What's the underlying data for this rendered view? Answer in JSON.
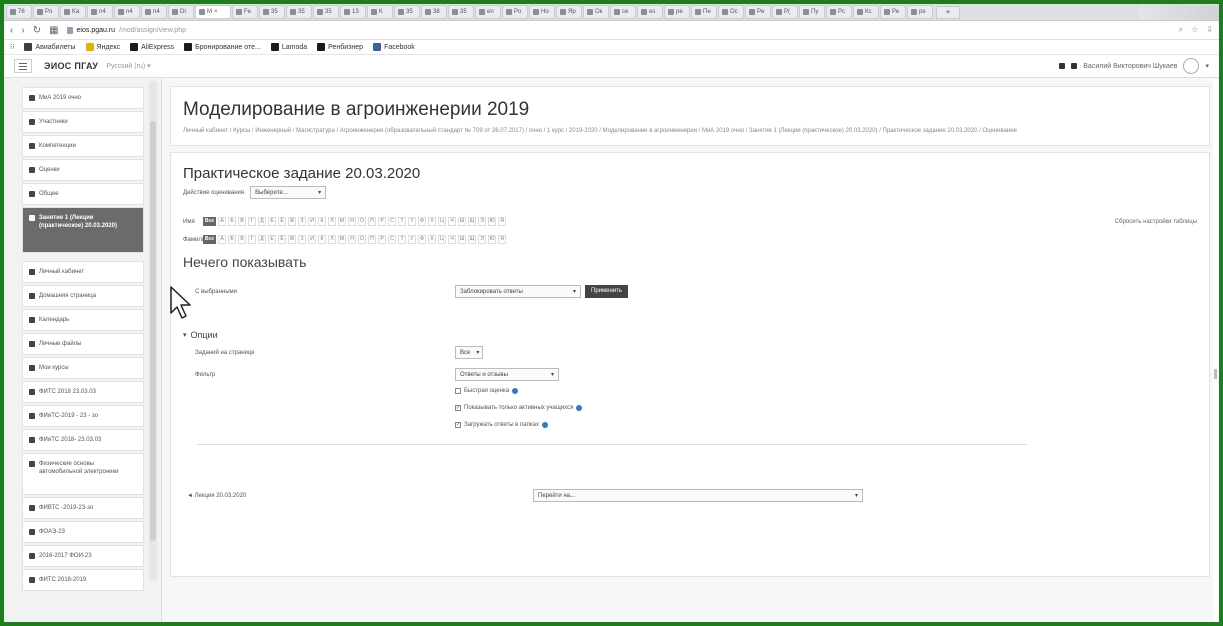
{
  "browser": {
    "tabs": [
      {
        "label": "76"
      },
      {
        "label": "Po"
      },
      {
        "label": "Ka"
      },
      {
        "label": "n4"
      },
      {
        "label": "n4"
      },
      {
        "label": "n4"
      },
      {
        "label": "Dr"
      },
      {
        "label": "M",
        "active": true
      },
      {
        "label": "Fe"
      },
      {
        "label": "35"
      },
      {
        "label": "35"
      },
      {
        "label": "35"
      },
      {
        "label": "13"
      },
      {
        "label": "К"
      },
      {
        "label": "35"
      },
      {
        "label": "38"
      },
      {
        "label": "35"
      },
      {
        "label": "en"
      },
      {
        "label": "Po"
      },
      {
        "label": "Но"
      },
      {
        "label": "Яр"
      },
      {
        "label": "Ок"
      },
      {
        "label": "ce"
      },
      {
        "label": "es"
      },
      {
        "label": "pe"
      },
      {
        "label": "Пн"
      },
      {
        "label": "Ос"
      },
      {
        "label": "Pe"
      },
      {
        "label": "P("
      },
      {
        "label": "Пу"
      },
      {
        "label": "Pc"
      },
      {
        "label": "Кс"
      },
      {
        "label": "Ре"
      },
      {
        "label": "pe"
      }
    ],
    "url_host": "eios.pgau.ru",
    "url_path": "/mod/assign/view.php",
    "bookmarks": [
      "Авиабилеты",
      "Яндекс",
      "AliExpress",
      "Бронирование оте...",
      "Lamoda",
      "Ренбизнер",
      "Facebook"
    ]
  },
  "navbar": {
    "brand": "ЭИОС ПГАУ",
    "lang": "Русский (ru)",
    "user": "Василий Викторович Шукаев"
  },
  "drawer": {
    "items": [
      {
        "label": "МиА 2019 очно"
      },
      {
        "label": "Участники"
      },
      {
        "label": "Компетенции"
      },
      {
        "label": "Оценки"
      },
      {
        "label": "Общее"
      },
      {
        "label": "Занятие 1 (Лекции (практическое) 20.03.2020)",
        "active": true
      },
      {
        "label": "Личный кабинет",
        "gap": true
      },
      {
        "label": "Домашняя страница"
      },
      {
        "label": "Календарь"
      },
      {
        "label": "Личные файлы"
      },
      {
        "label": "Мои курсы"
      },
      {
        "label": "ФИТС 2018 23.03.03"
      },
      {
        "label": "ФИиТС-2019 - 23 - зо"
      },
      {
        "label": "ФИиТС 2018- 23.03.03"
      },
      {
        "label": "Физические основы автомобильной электроники",
        "tall": true
      },
      {
        "label": "ФИВТС -2019-23-зо"
      },
      {
        "label": "ФОАЭ-23"
      },
      {
        "label": "2016-2017 ФОИ-23"
      },
      {
        "label": "ФИТС 2018-2019"
      }
    ]
  },
  "course": {
    "title": "Моделирование в агроинженерии 2019",
    "breadcrumb": "Личный кабинет / Курсы / Инженерный / Магистратура / Агроинженерия (образовательный стандарт № 709 от 26.07.2017) / очно / 1 курс / 2019-2020 / Моделирование в агроинженерии / МиА 2019 очно / Занятие 1 (Лекции (практическое) 20.03.2020) / Практическое задание 20.03.2020 / Оценивание"
  },
  "assignment": {
    "title": "Практическое задание 20.03.2020",
    "grading_action_label": "Действие оценивания",
    "grading_action_value": "Выберите...",
    "reset_label": "Сбросить настройки таблицы",
    "firstname_label": "Имя",
    "lastname_label": "Фамилия",
    "all_label": "Все",
    "letters": [
      "А",
      "Б",
      "В",
      "Г",
      "Д",
      "Е",
      "Ё",
      "Ж",
      "З",
      "И",
      "К",
      "Л",
      "М",
      "Н",
      "О",
      "П",
      "Р",
      "С",
      "Т",
      "У",
      "Ф",
      "Х",
      "Ц",
      "Ч",
      "Ш",
      "Щ",
      "Э",
      "Ю",
      "Я"
    ],
    "nothing": "Нечего показывать",
    "with_selected_label": "С выбранными",
    "with_selected_value": "Заблокировать ответы",
    "apply_label": "Применить",
    "options_label": "Опции",
    "per_page_label": "Заданий на странице",
    "per_page_value": "Все",
    "filter_label": "Фильтр",
    "filter_value": "Ответы и отзывы",
    "quick_grading": "Быстрая оценка",
    "quick_grading_checked": false,
    "only_active": "Показывать только активных учащихся",
    "only_active_checked": true,
    "download_folders": "Загружать ответы в папках",
    "download_folders_checked": true,
    "prev_link": "◄ Лекция 20.03.2020",
    "jump_value": "Перейти на..."
  }
}
